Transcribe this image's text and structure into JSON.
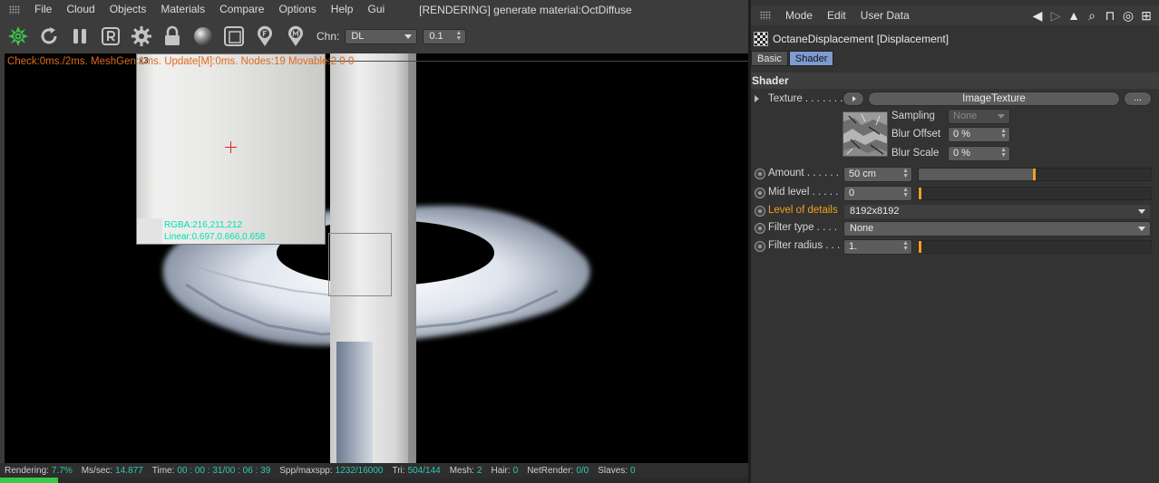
{
  "viewer": {
    "menu": [
      "File",
      "Cloud",
      "Objects",
      "Materials",
      "Compare",
      "Options",
      "Help",
      "Gui"
    ],
    "window_title": "[RENDERING] generate material:OctDiffuse",
    "toolbar": {
      "channel_label": "Chn:",
      "channel_value": "DL",
      "channel_param": "0.1"
    },
    "render_info": "Check:0ms./2ms. MeshGen:1ms. Update[M]:0ms. Nodes:19 Movable:2  0 0",
    "zoom": {
      "label": "x3",
      "pixel_line1": "RGBA:216,211,212",
      "pixel_line2": "Linear:0.697,0.666,0.658"
    },
    "status": [
      {
        "key": "Rendering:",
        "value": "7.7%"
      },
      {
        "key": "Ms/sec:",
        "value": "14.877"
      },
      {
        "key": "Time:",
        "value": "00 : 00 : 31/00 : 06 : 39"
      },
      {
        "key": "Spp/maxspp:",
        "value": "1232/16000"
      },
      {
        "key": "Tri:",
        "value": "504/144"
      },
      {
        "key": "Mesh:",
        "value": "2"
      },
      {
        "key": "Hair:",
        "value": "0"
      },
      {
        "key": "NetRender:",
        "value": "0/0"
      },
      {
        "key": "Slaves:",
        "value": "0"
      }
    ],
    "progress_fraction": 0.077
  },
  "attributes": {
    "menu": [
      "Mode",
      "Edit",
      "User Data"
    ],
    "object_title": "OctaneDisplacement [Displacement]",
    "tabs": [
      {
        "label": "Basic",
        "active": false
      },
      {
        "label": "Shader",
        "active": true
      }
    ],
    "section_title": "Shader",
    "texture": {
      "label": "Texture . . . . . . .",
      "button_label": "ImageTexture",
      "more_label": "..."
    },
    "sub": {
      "sampling_label": "Sampling",
      "sampling_value": "None",
      "blur_offset_label": "Blur Offset",
      "blur_offset_value": "0 %",
      "blur_scale_label": "Blur Scale",
      "blur_scale_value": "0 %"
    },
    "params": {
      "amount_label": "Amount . . . . . .",
      "amount_value": "50 cm",
      "amount_fraction": 0.5,
      "mid_level_label": "Mid level  . . . . .",
      "mid_level_value": "0",
      "mid_level_fraction": 0.0,
      "lod_label": "Level of details",
      "lod_value": "8192x8192",
      "filter_type_label": "Filter type  . . . .",
      "filter_type_value": "None",
      "filter_radius_label": "Filter radius . . .",
      "filter_radius_value": "1.",
      "filter_radius_fraction": 0.0
    },
    "accent_color": "#f0a020",
    "active_tab_color": "#7d9bd0"
  }
}
